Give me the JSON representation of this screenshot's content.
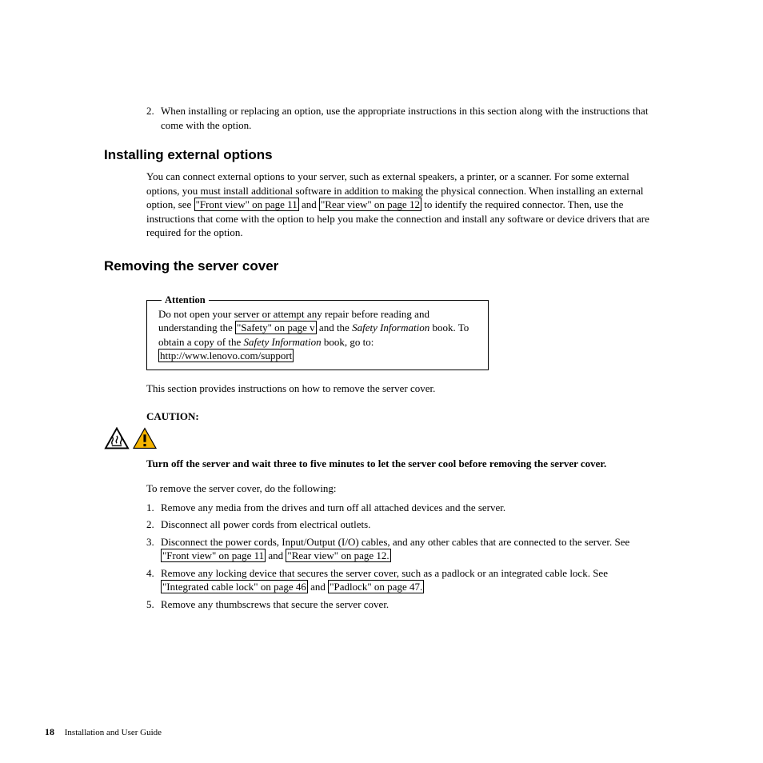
{
  "continuation": {
    "num": "2.",
    "text": "When installing or replacing an option, use the appropriate instructions in this section along with the instructions that come with the option."
  },
  "s1": {
    "heading": "Installing external options",
    "p1a": "You can connect external options to your server, such as external speakers, a printer, or a scanner. For some external options, you must install additional software in addition to making the physical connection. When installing an external option, see ",
    "link1": "\"Front view\" on page 11",
    "p1b": " and ",
    "link2": "\"Rear view\" on page 12",
    "p1c": " to identify the required connector. Then, use the instructions that come with the option to help you make the connection and install any software or device drivers that are required for the option."
  },
  "s2": {
    "heading": "Removing the server cover",
    "attention": {
      "label": "Attention",
      "p1a": "Do not open your server or attempt any repair before reading and understanding the ",
      "link1": "\"Safety\" on page v",
      "p1b": " and the ",
      "italic1": "Safety Information",
      "p1c": " book. To obtain a copy of the ",
      "italic2": "Safety Information",
      "p1d": " book, go to:",
      "url": "http://www.lenovo.com/support"
    },
    "p_intro": "This section provides instructions on how to remove the server cover.",
    "caution_label": "CAUTION:",
    "caution_text": "Turn off the server and wait three to five minutes to let the server cool before removing the server cover.",
    "p_steps_intro": "To remove the server cover, do the following:",
    "steps": [
      {
        "num": "1.",
        "a": "Remove any media from the drives and turn off all attached devices and the server."
      },
      {
        "num": "2.",
        "a": "Disconnect all power cords from electrical outlets."
      },
      {
        "num": "3.",
        "a": "Disconnect the power cords, Input/Output (I/O) cables, and any other cables that are connected to the server. See ",
        "l1": "\"Front view\" on page 11",
        "b": " and ",
        "l2": "\"Rear view\" on page 12.",
        "c": ""
      },
      {
        "num": "4.",
        "a": "Remove any locking device that secures the server cover, such as a padlock or an integrated cable lock. See ",
        "l1": "\"Integrated cable lock\" on page 46",
        "b": " and ",
        "l2": "\"Padlock\" on page 47.",
        "c": ""
      },
      {
        "num": "5.",
        "a": "Remove any thumbscrews that secure the server cover."
      }
    ]
  },
  "footer": {
    "page": "18",
    "title": "Installation and User Guide"
  }
}
